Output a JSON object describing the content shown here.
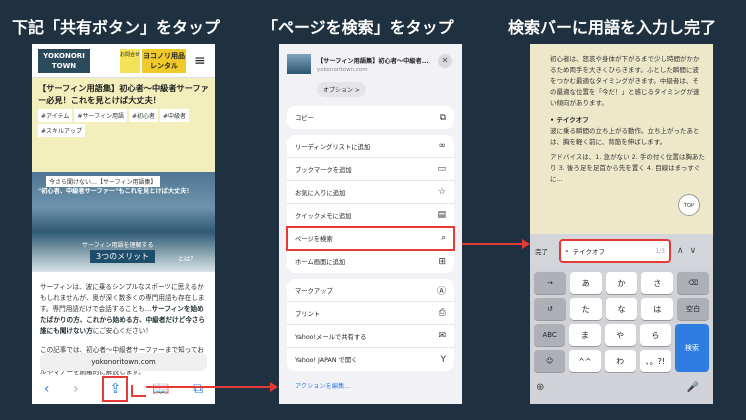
{
  "headings": {
    "step1": "下記「共有ボタン」をタップ",
    "step2": "「ページを検索」をタップ",
    "step3": "検索バーに用語を入力し完了"
  },
  "phone1": {
    "logo": "YOKONORI TOWN",
    "mail_label": "お問合せ",
    "rental_label": "ヨコノリ用品 レンタル",
    "article_title": "【サーフィン用語集】初心者〜中級者サーファー必見！これを見とけば大丈夫！",
    "tags": [
      "#アイテム",
      "#サーフィン用語",
      "#初心者",
      "#中級者",
      "#スキルアップ"
    ],
    "hero_caption1": "今さら聞けない…【サーフィン用語集】",
    "hero_caption2": "\"初心者、中級者サーファー\"もこれを見とけば大丈夫！",
    "hero_merit_sub": "サーフィン用語を理解する",
    "hero_merit": "3つのメリット",
    "hero_question": "とは？",
    "body_para1_start": "サーフィンは、波に乗るシンプルなスポーツに思えるかもしれませんが、奥が深く数多くの専門用語も存在します。専門用語だけで会話することも…",
    "body_para1_bold": "サーフィンを始めたばかりの方、これから始める方、中級者だけど今さら誰にも聞けない方",
    "body_para1_end": "にご安心ください！",
    "body_para2": "この記事では、初心者〜中級者サーファーまで知っておくべき基本的な波や海、道具、技術、天候のほか、ルールやマナーを網羅的に解説します。",
    "url": "yokonoritown.com",
    "toolbar_icons": [
      "back-icon",
      "forward-icon",
      "share-icon",
      "bookmarks-icon",
      "tabs-icon"
    ]
  },
  "phone2": {
    "sheet_title": "【サーフィン用語集】初心者〜中級者...",
    "sheet_url": "yokonoritown.com",
    "options_label": "オプション >",
    "groups": [
      [
        {
          "label": "コピー",
          "icon": "copy-icon"
        }
      ],
      [
        {
          "label": "リーディングリストに追加",
          "icon": "glasses-icon"
        },
        {
          "label": "ブックマークを追加",
          "icon": "book-icon"
        },
        {
          "label": "お気に入りに追加",
          "icon": "star-icon"
        },
        {
          "label": "クイックメモに追加",
          "icon": "memo-icon"
        },
        {
          "label": "ページを検索",
          "icon": "find-icon",
          "highlight": true
        },
        {
          "label": "ホーム画面に追加",
          "icon": "plus-square-icon"
        }
      ],
      [
        {
          "label": "マークアップ",
          "icon": "markup-icon"
        },
        {
          "label": "プリント",
          "icon": "print-icon"
        },
        {
          "label": "Yahoo!メールで共有する",
          "icon": "mail-icon"
        },
        {
          "label": "Yahoo! JAPAN で開く",
          "icon": "yahoo-icon"
        }
      ]
    ],
    "actions_link": "アクションを編集..."
  },
  "phone3": {
    "paragraph1": "初心者は、怒哀や身体が下がるまで少し時間がかかるため両手を大きくひらきます。ふとした瞬間に波をつかむ最適なタイミングがきます。中級者は、その最適な位置を「今だ！」と感じるタイミングが速い傾向があります。",
    "term": "テイクオフ",
    "paragraph2": "波に乗る瞬間の立ち上がる動作。立ち上がったあとは、胸を軽く前に、背筋を伸ばします。",
    "paragraph3": "アドバイスは、1. 急がない 2. 手の付く位置は胸あたり 3. 後ろ足を足首から先を置く 4. 目線はまっすぐに...",
    "top_label": "TOP",
    "done_label": "完了",
    "search_query": "テイクオフ",
    "search_count": "1/3",
    "keys": [
      [
        "→",
        "あ",
        "か",
        "さ",
        "⌫"
      ],
      [
        "↺",
        "た",
        "な",
        "は",
        "空白"
      ],
      [
        "ABC",
        "ま",
        "や",
        "ら"
      ],
      [
        "☺",
        "^^",
        "わ",
        "、。?!"
      ]
    ],
    "search_key": "検索"
  },
  "colors": {
    "background": "#1f3140",
    "highlight": "#e53935",
    "ios_blue": "#2f7de1"
  }
}
